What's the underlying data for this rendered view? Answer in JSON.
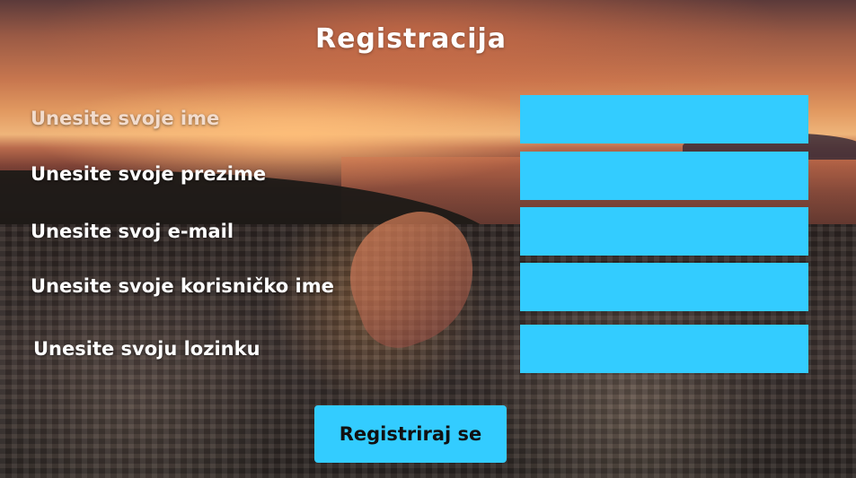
{
  "form": {
    "title": "Registracija",
    "fields": [
      {
        "label": "Unesite svoje ime",
        "value": "",
        "placeholder": ""
      },
      {
        "label": "Unesite svoje prezime",
        "value": "",
        "placeholder": ""
      },
      {
        "label": "Unesite svoj e-mail",
        "value": "",
        "placeholder": ""
      },
      {
        "label": "Unesite svoje korisničko ime",
        "value": "",
        "placeholder": ""
      },
      {
        "label": "Unesite svoju lozinku",
        "value": "",
        "placeholder": ""
      }
    ],
    "submit_label": "Registriraj se"
  },
  "colors": {
    "field_background": "#33ccff",
    "button_background": "#33ccff",
    "label_text": "#ffffff"
  }
}
